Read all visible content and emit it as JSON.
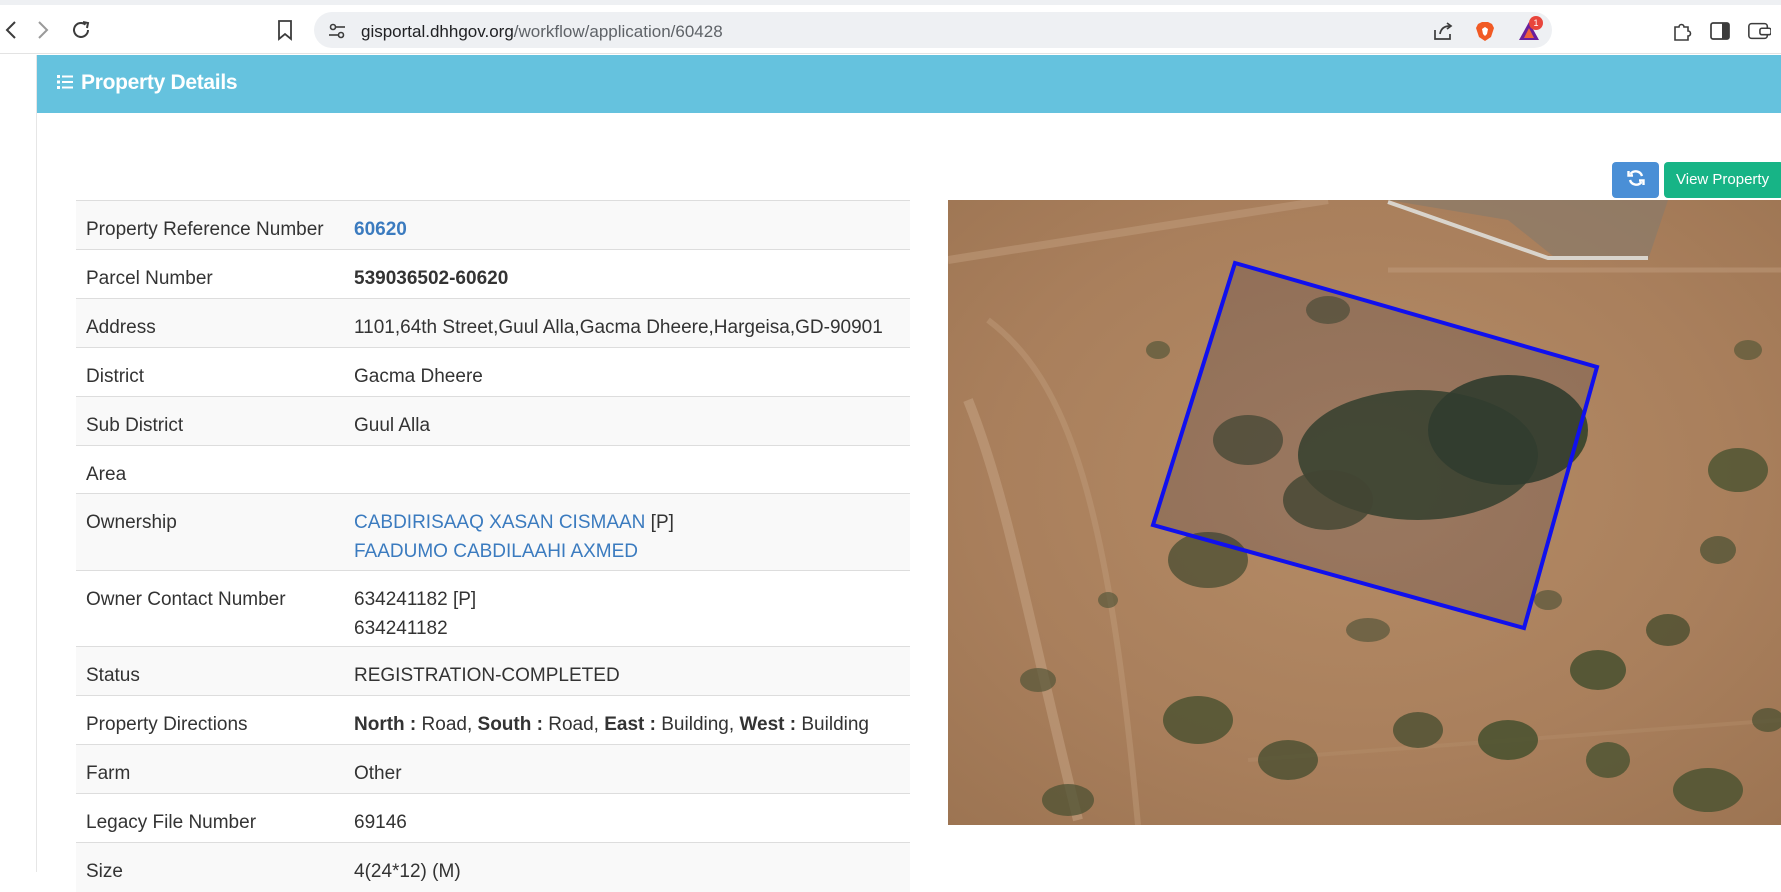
{
  "browser": {
    "url_domain": "gisportal.dhhgov.org",
    "url_path": "/workflow/application/60428",
    "brave_badge": "1"
  },
  "panel": {
    "title": "Property Details",
    "refresh_icon": "refresh-icon",
    "view_button": "View Property"
  },
  "details": {
    "ref": {
      "label": "Property Reference Number",
      "value": "60620"
    },
    "parcel": {
      "label": "Parcel Number",
      "value": "539036502-60620"
    },
    "address": {
      "label": "Address",
      "value": "1101,64th Street,Guul Alla,Gacma Dheere,Hargeisa,GD-90901"
    },
    "district": {
      "label": "District",
      "value": "Gacma Dheere"
    },
    "sub_district": {
      "label": "Sub District",
      "value": "Guul Alla"
    },
    "area": {
      "label": "Area",
      "value": ""
    },
    "ownership": {
      "label": "Ownership",
      "owner1": "CABDIRISAAQ XASAN CISMAAN",
      "owner1_tag": " [P]",
      "owner2": "FAADUMO CABDILAAHI AXMED"
    },
    "contact": {
      "label": "Owner Contact Number",
      "line1": "634241182 [P]",
      "line2": "634241182"
    },
    "status": {
      "label": "Status",
      "value": "REGISTRATION-COMPLETED"
    },
    "directions": {
      "label": "Property Directions",
      "north_label": "North :",
      "north_value": " Road, ",
      "south_label": "South :",
      "south_value": " Road, ",
      "east_label": "East :",
      "east_value": " Building, ",
      "west_label": "West :",
      "west_value": " Building"
    },
    "farm": {
      "label": "Farm",
      "value": "Other"
    },
    "legacy": {
      "label": "Legacy File Number",
      "value": "69146"
    },
    "size": {
      "label": "Size",
      "value": "4(24*12) (M)"
    }
  },
  "map": {
    "description_icon": "satellite-map",
    "boundary_color": "#1010ee"
  }
}
